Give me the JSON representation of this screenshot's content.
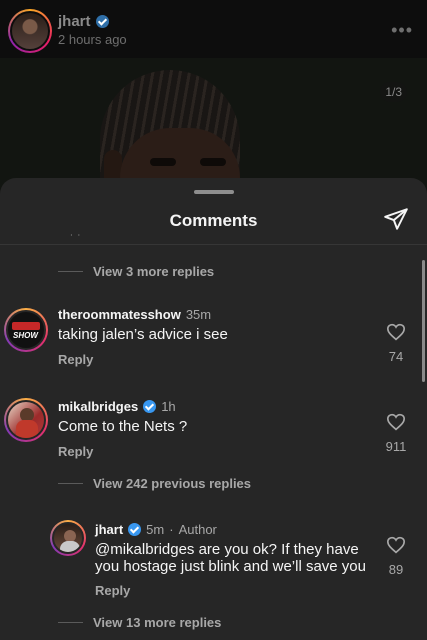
{
  "post": {
    "username": "jhart",
    "time": "2 hours ago",
    "more": "•••",
    "media_counter": "1/3"
  },
  "sheet": {
    "title": "Comments",
    "share_icon": "paper-plane-icon"
  },
  "threads": [
    {
      "view_more": "View 3 more replies"
    },
    {
      "username": "theroommatesshow",
      "time": "35m",
      "text": "taking jalen’s advice i see",
      "reply_label": "Reply",
      "likes": "74",
      "avatar_text": "SHOW"
    },
    {
      "username": "mikalbridges",
      "verified": true,
      "time": "1h",
      "text": "Come to the Nets ?",
      "reply_label": "Reply",
      "likes": "911",
      "view_previous": "View 242 previous replies",
      "reply": {
        "username": "jhart",
        "verified": true,
        "time": "5m",
        "author_tag": "Author",
        "text_line1": "@mikalbridges are you ok? If they have",
        "text_line2": "you hostage just blink and we’ll save you",
        "reply_label": "Reply",
        "likes": "89"
      },
      "view_more": "View 13 more replies"
    }
  ],
  "colors": {
    "sheet_bg": "#262626",
    "verified": "#3897f0",
    "secondary_text": "#a8a8a8"
  }
}
